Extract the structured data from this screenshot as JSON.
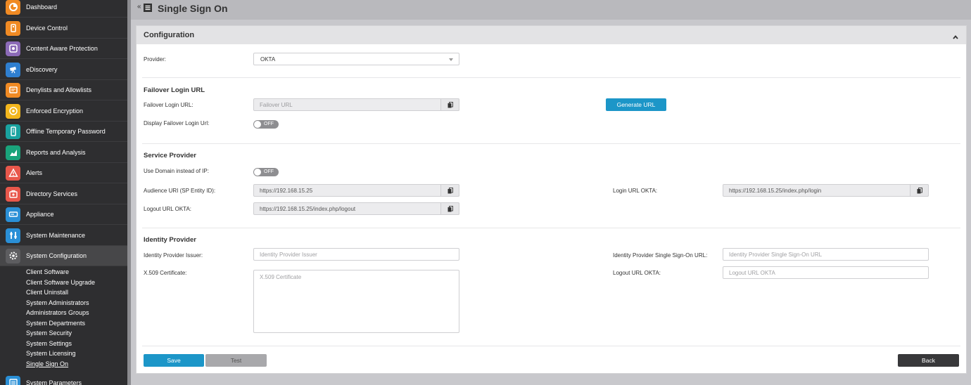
{
  "header": {
    "title": "Single Sign On",
    "back_glyph": "«"
  },
  "sidebar": {
    "items": [
      {
        "label": "Dashboard",
        "icon": "dashboard-icon",
        "color": "#f08a24"
      },
      {
        "label": "Device Control",
        "icon": "device-control-icon",
        "color": "#f08a24"
      },
      {
        "label": "Content Aware Protection",
        "icon": "content-aware-icon",
        "color": "#8b6ab7"
      },
      {
        "label": "eDiscovery",
        "icon": "ediscovery-icon",
        "color": "#2f7fd0"
      },
      {
        "label": "Denylists and Allowlists",
        "icon": "denylist-icon",
        "color": "#f08a24"
      },
      {
        "label": "Enforced Encryption",
        "icon": "encryption-icon",
        "color": "#f3b61d"
      },
      {
        "label": "Offline Temporary Password",
        "icon": "offline-password-icon",
        "color": "#1aa3a0"
      },
      {
        "label": "Reports and Analysis",
        "icon": "reports-icon",
        "color": "#1aa37b"
      },
      {
        "label": "Alerts",
        "icon": "alerts-icon",
        "color": "#e8574b"
      },
      {
        "label": "Directory Services",
        "icon": "directory-services-icon",
        "color": "#e8574b"
      },
      {
        "label": "Appliance",
        "icon": "appliance-icon",
        "color": "#2a8fd6"
      },
      {
        "label": "System Maintenance",
        "icon": "maintenance-icon",
        "color": "#2a8fd6"
      },
      {
        "label": "System Configuration",
        "icon": "gear-icon",
        "color": "#5d5d60"
      }
    ],
    "subitems": [
      "Client Software",
      "Client Software Upgrade",
      "Client Uninstall",
      "System Administrators",
      "Administrators Groups",
      "System Departments",
      "System Security",
      "System Settings",
      "System Licensing",
      "Single Sign On"
    ],
    "bottom_item": {
      "label": "System Parameters",
      "icon": "parameters-icon",
      "color": "#2a8fd6"
    }
  },
  "panel": {
    "title": "Configuration",
    "provider": {
      "label": "Provider:",
      "value": "OKTA"
    },
    "failover": {
      "section_title": "Failover Login URL",
      "url_label": "Failover Login URL:",
      "url_placeholder": "Failover URL",
      "generate_label": "Generate URL",
      "display_label": "Display Failover Login Url:",
      "display_state": "OFF"
    },
    "service_provider": {
      "section_title": "Service Provider",
      "use_domain_label": "Use Domain instead of IP:",
      "use_domain_state": "OFF",
      "audience_label": "Audience URI (SP Entity ID):",
      "audience_value": "https://192.168.15.25",
      "logout_label": "Logout URL OKTA:",
      "logout_value": "https://192.168.15.25/index.php/logout",
      "login_label": "Login URL OKTA:",
      "login_value": "https://192.168.15.25/index.php/login"
    },
    "identity_provider": {
      "section_title": "Identity Provider",
      "issuer_label": "Identity Provider Issuer:",
      "issuer_placeholder": "Identity Provider Issuer",
      "cert_label": "X.509 Certificate:",
      "cert_placeholder": "X.509 Certificate",
      "sso_url_label": "Identity Provider Single Sign-On URL:",
      "sso_url_placeholder": "Identity Provider Single Sign-On URL",
      "logout_label": "Logout URL OKTA:",
      "logout_placeholder": "Logout URL OKTA"
    },
    "buttons": {
      "save": "Save",
      "test": "Test",
      "back": "Back"
    }
  },
  "colors": {
    "accent": "#1c96c8",
    "sidebar_bg": "#2e2e30",
    "toggle_off": "#8e8e91"
  }
}
